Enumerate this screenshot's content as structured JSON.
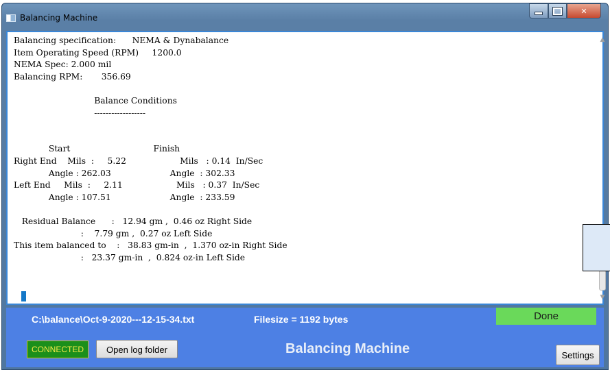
{
  "window": {
    "title": "Balancing Machine"
  },
  "report_text": "Balancing specification:      NEMA & Dynabalance\nItem Operating Speed (RPM)     1200.0\nNEMA Spec: 2.000 mil\nBalancing RPM:       356.69\n\n                              Balance Conditions\n                              ------------------\n\n\n             Start                               Finish\nRight End    Mils  :     5.22                    Mils   : 0.14  In/Sec\n             Angle : 262.03                      Angle  : 302.33\nLeft End     Mils  :     2.11                    Mils   : 0.37  In/Sec\n             Angle : 107.51                      Angle  : 233.59\n\n   Residual Balance      :   12.94 gm ,  0.46 oz Right Side\n                         :    7.79 gm ,  0.27 oz Left Side\nThis item balanced to    :   38.83 gm-in  ,  1.370 oz-in Right Side\n                         :   23.37 gm-in  ,  0.824 oz-in Left Side",
  "status": {
    "file_path": "C:\\balance\\Oct-9-2020---12-15-34.txt",
    "file_size": "Filesize = 1192 bytes",
    "done_label": "Done",
    "connection": "CONNECTED",
    "open_log_label": "Open log folder",
    "app_name": "Balancing Machine",
    "settings_label": "Settings"
  },
  "colors": {
    "status_bar": "#4d80e4",
    "done": "#6ad95a",
    "connected_bg": "#1b8f1b",
    "connected_text": "#f6e84a"
  },
  "icons": [
    "app-icon",
    "minimize-icon",
    "maximize-icon",
    "close-icon",
    "scroll-up-icon",
    "scroll-down-icon"
  ]
}
